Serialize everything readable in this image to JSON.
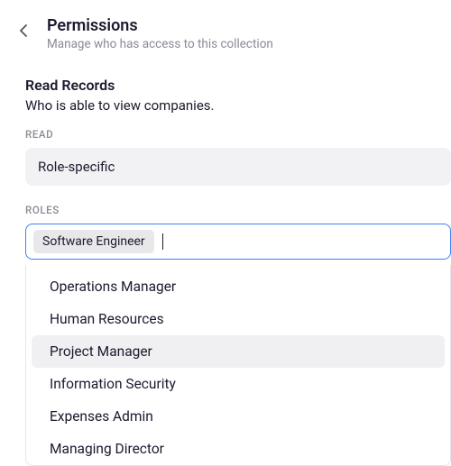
{
  "header": {
    "title": "Permissions",
    "subtitle": "Manage who has access to this collection"
  },
  "section": {
    "title": "Read Records",
    "description": "Who is able to view companies."
  },
  "read_field": {
    "label": "READ",
    "value": "Role-specific"
  },
  "roles_field": {
    "label": "ROLES",
    "selected": [
      "Software Engineer"
    ]
  },
  "dropdown": {
    "options": [
      {
        "label": "Operations Manager",
        "highlighted": false
      },
      {
        "label": "Human Resources",
        "highlighted": false
      },
      {
        "label": "Project Manager",
        "highlighted": true
      },
      {
        "label": "Information Security",
        "highlighted": false
      },
      {
        "label": "Expenses Admin",
        "highlighted": false
      },
      {
        "label": "Managing Director",
        "highlighted": false
      }
    ]
  }
}
